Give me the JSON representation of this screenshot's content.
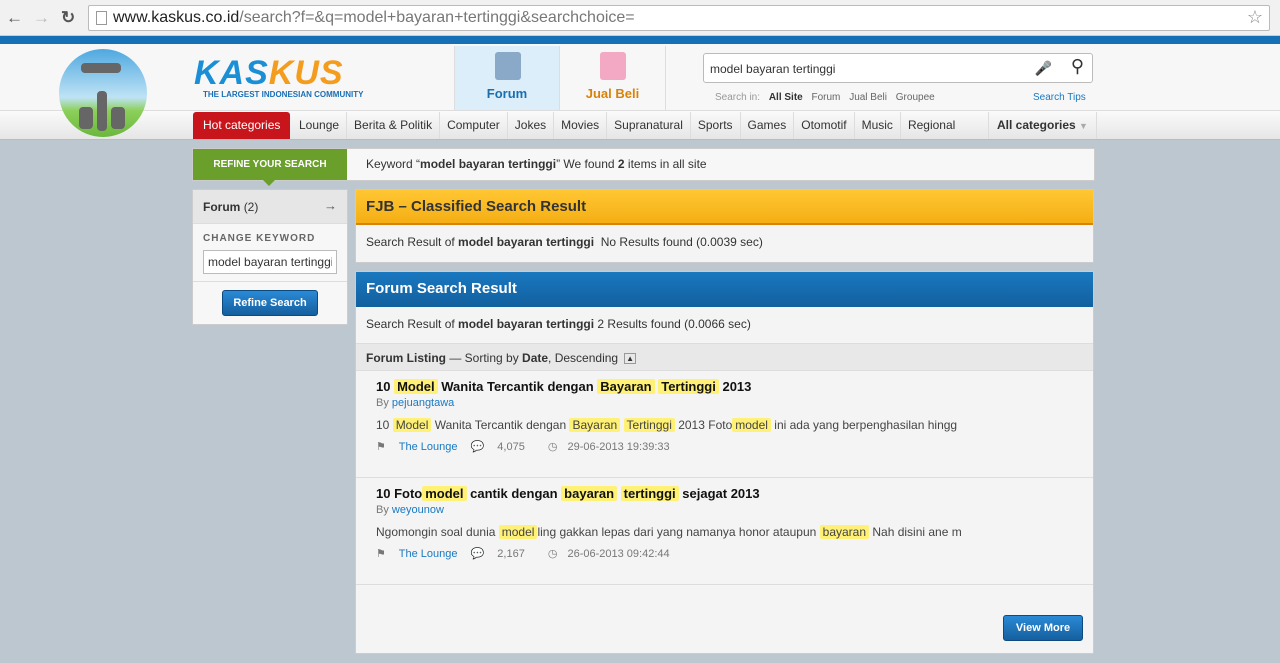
{
  "browser": {
    "url_host": "www.kaskus.co.id",
    "url_path": "/search?f=&q=model+bayaran+tertinggi&searchchoice="
  },
  "header": {
    "logo_text_a": "KAS",
    "logo_text_b": "KUS",
    "tagline": "THE LARGEST INDONESIAN COMMUNITY",
    "tabs": [
      {
        "label": "Forum"
      },
      {
        "label": "Jual Beli"
      }
    ],
    "search_value": "model bayaran tertinggi",
    "search_in_label": "Search in:",
    "search_in": [
      "All Site",
      "Forum",
      "Jual Beli",
      "Groupee"
    ],
    "search_tips": "Search Tips"
  },
  "categories": {
    "hot": "Hot categories",
    "items": [
      "Lounge",
      "Berita & Politik",
      "Computer",
      "Jokes",
      "Movies",
      "Supranatural",
      "Sports",
      "Games",
      "Otomotif",
      "Music",
      "Regional"
    ],
    "all": "All categories"
  },
  "refine": {
    "tag": "REFINE YOUR SEARCH",
    "kw_prefix": "Keyword “",
    "keyword": "model bayaran tertinggi",
    "kw_mid": "” We found ",
    "count": "2",
    "kw_suffix": " items in all site"
  },
  "sidebar": {
    "forum_label": "Forum",
    "forum_count": "(2)",
    "change_keyword": "CHANGE KEYWORD",
    "keyword_value": "model bayaran tertinggi",
    "refine_button": "Refine Search"
  },
  "fjb": {
    "title": "FJB – Classified Search Result",
    "prefix": "Search Result of ",
    "keyword": "model bayaran tertinggi",
    "result": "  No Results found (0.0039 sec)"
  },
  "forum": {
    "title": "Forum Search Result",
    "prefix": "Search Result of ",
    "keyword": "model bayaran tertinggi",
    "result": " 2 Results found (0.0066 sec)",
    "listing_label": "Forum Listing",
    "sort_prefix": " — Sorting by ",
    "sort_field": "Date",
    "sort_order": ", Descending",
    "items": [
      {
        "title": [
          [
            "10 ",
            false
          ],
          [
            "Model",
            true
          ],
          [
            " Wanita Tercantik dengan ",
            false
          ],
          [
            "Bayaran",
            true
          ],
          [
            " ",
            false
          ],
          [
            "Tertinggi",
            true
          ],
          [
            " 2013",
            false
          ]
        ],
        "by": "By ",
        "author": "pejuangtawa",
        "snippet": [
          [
            "10 ",
            false
          ],
          [
            "Model",
            true
          ],
          [
            " Wanita Tercantik dengan ",
            false
          ],
          [
            "Bayaran",
            true
          ],
          [
            " ",
            false
          ],
          [
            "Tertinggi",
            true
          ],
          [
            " 2013 Foto",
            false
          ],
          [
            "model",
            true
          ],
          [
            " ini ada yang berpenghasilan hingg",
            false
          ]
        ],
        "forum": "The Lounge",
        "views": "4,075",
        "date": "29-06-2013 19:39:33"
      },
      {
        "title": [
          [
            "10 Foto",
            false
          ],
          [
            "model",
            true
          ],
          [
            " cantik dengan ",
            false
          ],
          [
            "bayaran",
            true
          ],
          [
            " ",
            false
          ],
          [
            "tertinggi",
            true
          ],
          [
            " sejagat 2013",
            false
          ]
        ],
        "by": "By ",
        "author": "weyounow",
        "snippet": [
          [
            "Ngomongin soal dunia ",
            false
          ],
          [
            "model",
            true
          ],
          [
            "ling gakkan lepas dari yang namanya honor ataupun ",
            false
          ],
          [
            "bayaran",
            true
          ],
          [
            " Nah disini ane m",
            false
          ]
        ],
        "forum": "The Lounge",
        "views": "2,167",
        "date": "26-06-2013 09:42:44"
      }
    ],
    "view_more": "View More"
  },
  "colors": {
    "brand_blue": "#1570b5",
    "hot_red": "#c8141b",
    "refine_green": "#6b9f2b",
    "fjb_orange": "#f5ae14",
    "highlight": "#fff176"
  }
}
